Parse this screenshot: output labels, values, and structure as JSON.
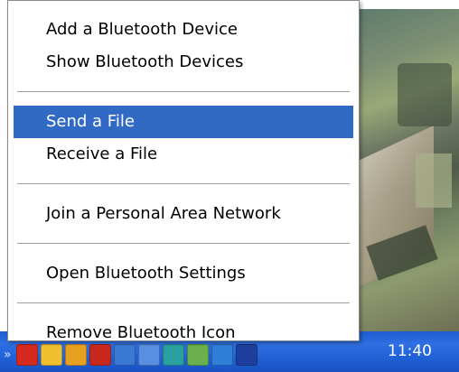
{
  "menu": {
    "groups": [
      {
        "items": [
          {
            "label": "Add a Bluetooth Device",
            "selected": false
          },
          {
            "label": "Show Bluetooth Devices",
            "selected": false
          }
        ]
      },
      {
        "items": [
          {
            "label": "Send a File",
            "selected": true
          },
          {
            "label": "Receive a File",
            "selected": false
          }
        ]
      },
      {
        "items": [
          {
            "label": "Join a Personal Area Network",
            "selected": false
          }
        ]
      },
      {
        "items": [
          {
            "label": "Open Bluetooth Settings",
            "selected": false
          }
        ]
      },
      {
        "items": [
          {
            "label": "Remove Bluetooth Icon",
            "selected": false
          }
        ]
      }
    ]
  },
  "taskbar": {
    "clock": "11:40",
    "tray_icons": [
      {
        "name": "show-hidden-icons-chevron",
        "color": "#1c5ccf"
      },
      {
        "name": "pdf-reader-icon",
        "color": "#d42b1e"
      },
      {
        "name": "folder-icon",
        "color": "#f0c030"
      },
      {
        "name": "smiley-icon",
        "color": "#e8a020"
      },
      {
        "name": "shield-icon",
        "color": "#c8281c"
      },
      {
        "name": "network-disconnected-icon",
        "color": "#3a78d6"
      },
      {
        "name": "network-icon",
        "color": "#5a8ee0"
      },
      {
        "name": "bluetooth-manager-icon",
        "color": "#2aa0a0"
      },
      {
        "name": "update-icon",
        "color": "#6ab04c"
      },
      {
        "name": "connection-icon",
        "color": "#2f7fd8"
      },
      {
        "name": "bluetooth-icon",
        "color": "#1e3f9e"
      }
    ]
  },
  "colors": {
    "highlight": "#316ac5",
    "taskbar": "#2f6fe4"
  }
}
